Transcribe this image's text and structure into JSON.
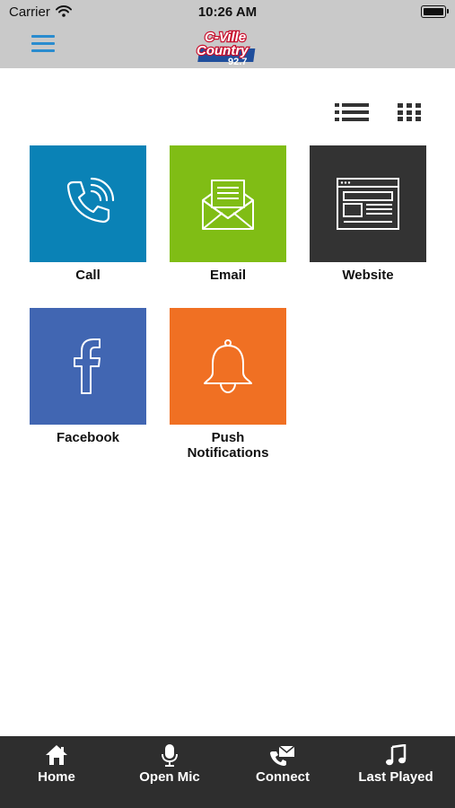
{
  "status_bar": {
    "carrier": "Carrier",
    "time": "10:26 AM"
  },
  "header": {
    "logo": {
      "line1": "C-Ville",
      "line2": "Country",
      "line3": "92.7"
    }
  },
  "view_modes": [
    "list-view-icon",
    "grid-view-icon"
  ],
  "tiles": [
    {
      "label": "Call",
      "color": "#0a82b6",
      "icon": "phone-icon"
    },
    {
      "label": "Email",
      "color": "#80bd15",
      "icon": "envelope-icon"
    },
    {
      "label": "Website",
      "color": "#333333",
      "icon": "browser-window-icon"
    },
    {
      "label": "Facebook",
      "color": "#4166b2",
      "icon": "facebook-icon"
    },
    {
      "label": "Push\nNotifications",
      "color": "#f07023",
      "icon": "bell-icon"
    }
  ],
  "tab_bar": {
    "items": [
      {
        "label": "Home",
        "icon": "home-icon"
      },
      {
        "label": "Open Mic",
        "icon": "microphone-icon"
      },
      {
        "label": "Connect",
        "icon": "connect-icon"
      },
      {
        "label": "Last Played",
        "icon": "music-note-icon"
      }
    ]
  }
}
